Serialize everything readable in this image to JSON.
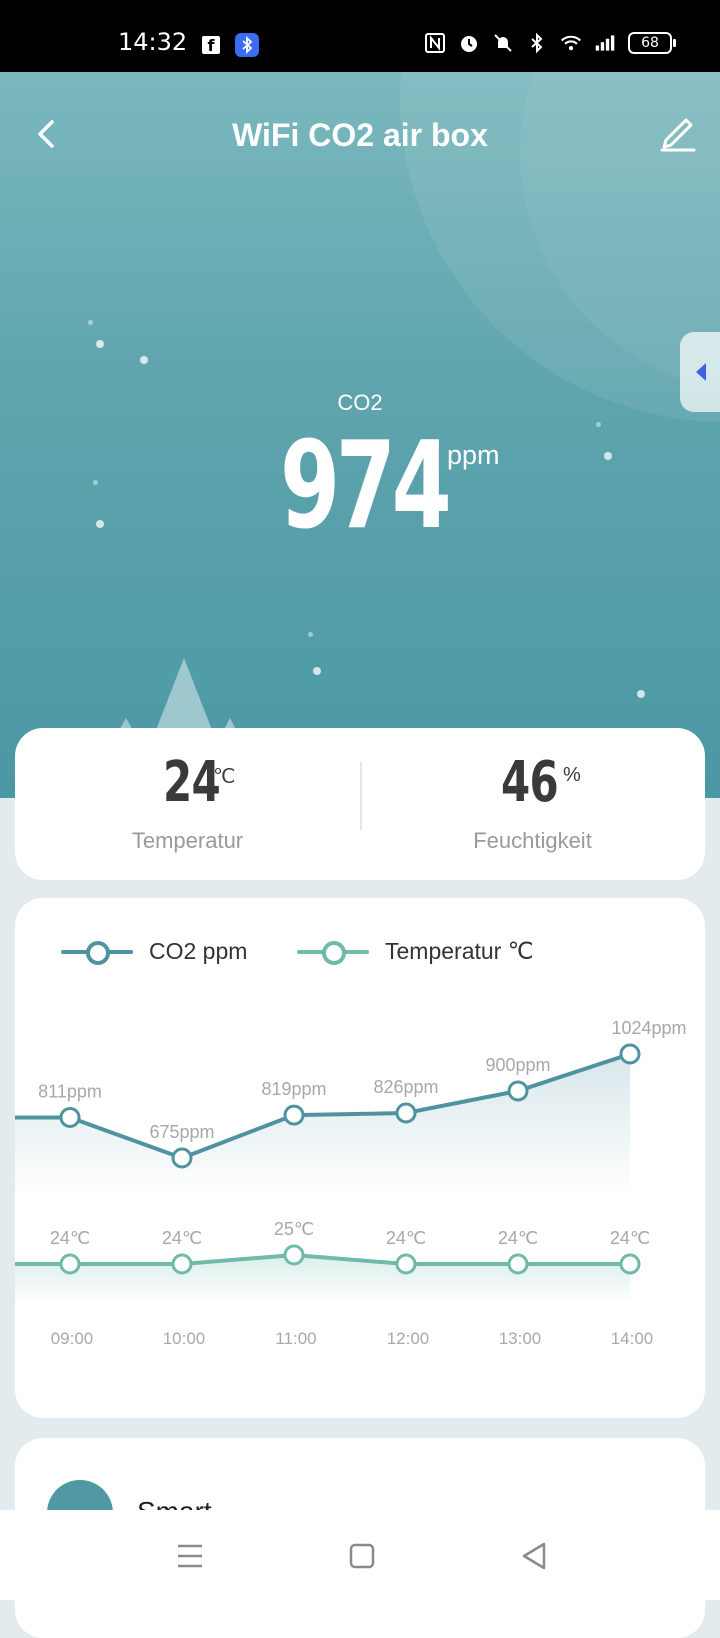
{
  "status_bar": {
    "time": "14:32",
    "battery": "68"
  },
  "header": {
    "title": "WiFi CO2 air box"
  },
  "hero": {
    "co2_label": "CO2",
    "co2_value": "974",
    "co2_unit": "ppm"
  },
  "environment": {
    "temperature": {
      "value": "24",
      "unit": "℃",
      "label": "Temperatur"
    },
    "humidity": {
      "value": "46",
      "unit": "%",
      "label": "Feuchtigkeit"
    }
  },
  "chart_data": {
    "type": "line",
    "legend": [
      "CO2 ppm",
      "Temperatur ℃"
    ],
    "categories": [
      "09:00",
      "10:00",
      "11:00",
      "12:00",
      "13:00",
      "14:00"
    ],
    "series": [
      {
        "name": "CO2 ppm",
        "values": [
          811,
          675,
          819,
          826,
          900,
          1024
        ],
        "labels": [
          "811ppm",
          "675ppm",
          "819ppm",
          "826ppm",
          "900ppm",
          "1024ppm"
        ],
        "color": "#4f93a0"
      },
      {
        "name": "Temperatur ℃",
        "values": [
          24,
          24,
          25,
          24,
          24,
          24
        ],
        "labels": [
          "24℃",
          "24℃",
          "25℃",
          "24℃",
          "24℃",
          "24℃"
        ],
        "color": "#6fbaa9"
      }
    ],
    "grid": false,
    "legend_position": "top-left"
  },
  "bottom_card": {
    "partial_text": "Smart"
  },
  "colors": {
    "hero_top": "#7ab8bd",
    "hero_bottom": "#4a98a4",
    "accent": "#4f93a0"
  }
}
